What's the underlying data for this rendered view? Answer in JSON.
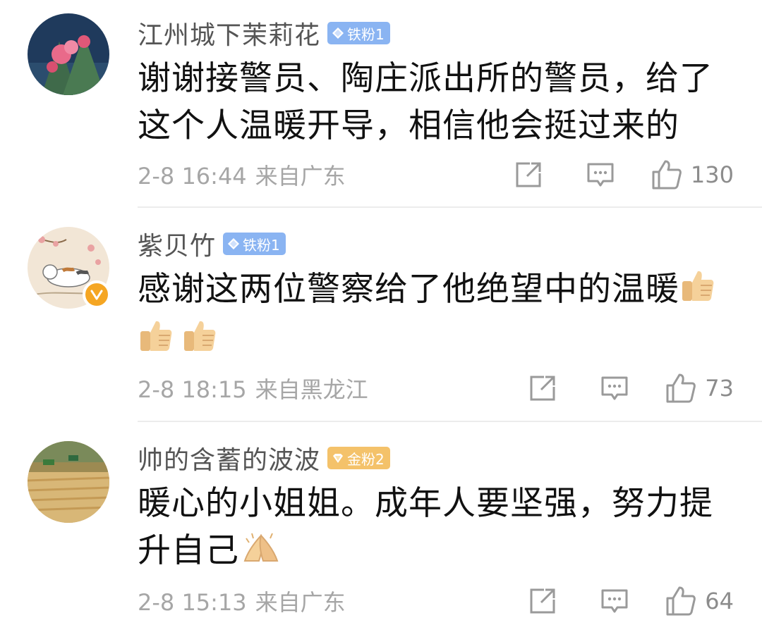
{
  "comments": [
    {
      "username": "江州城下茉莉花",
      "badge": "铁粉1",
      "text": "谢谢接警员、陶庄派出所的警员，给了这个人温暖开导，相信他会挺过来的",
      "time": "2-8 16:44",
      "location": "来自广东",
      "likes": "130"
    },
    {
      "username": "紫贝竹",
      "badge": "铁粉1",
      "text": "感谢这两位警察给了他绝望中的温暖",
      "time": "2-8 18:15",
      "location": "来自黑龙江",
      "likes": "73"
    },
    {
      "username": "帅的含蓄的波波",
      "badge": "金粉2",
      "text": "暖心的小姐姐。成年人要坚强，努力提升自己",
      "time": "2-8 15:13",
      "location": "来自广东",
      "likes": "64"
    }
  ],
  "colors": {
    "iron_badge": "#8ab4f2",
    "gold_badge": "#f4c26a",
    "verified": "#f5a623",
    "meta_text": "#a6a6a6"
  },
  "icons": [
    "share-icon",
    "reply-icon",
    "like-icon",
    "thumbs-up-emoji",
    "palms-together-emoji",
    "verified-icon"
  ]
}
